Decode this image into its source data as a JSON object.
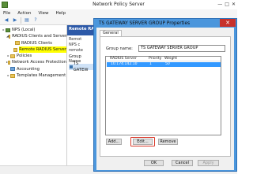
{
  "window": {
    "title": "Network Policy Server",
    "btn_min": "—",
    "btn_max": "□",
    "btn_close": "✕"
  },
  "menu": [
    "File",
    "Action",
    "View",
    "Help"
  ],
  "toolbar": {
    "icons": [
      "back-icon",
      "forward-icon",
      "properties-icon",
      "help-icon"
    ],
    "glyphs": [
      "◀",
      "▶",
      "▤",
      "?"
    ]
  },
  "tree": {
    "items": [
      {
        "label": "NPS (Local)",
        "indent": 0,
        "expander": "▸",
        "icon": "root",
        "name": "tree-item-nps-local"
      },
      {
        "label": "RADIUS Clients and Servers",
        "indent": 1,
        "expander": "◢",
        "icon": "folder",
        "name": "tree-item-radius-clients-and-servers"
      },
      {
        "label": "RADIUS Clients",
        "indent": 2,
        "expander": "",
        "icon": "folder",
        "name": "tree-item-radius-clients"
      },
      {
        "label": "Remote RADIUS Server",
        "indent": 2,
        "expander": "",
        "icon": "folder",
        "name": "tree-item-remote-radius-server",
        "selected": true
      },
      {
        "label": "Policies",
        "indent": 1,
        "expander": "▸",
        "icon": "folder",
        "name": "tree-item-policies"
      },
      {
        "label": "Network Access Protection",
        "indent": 1,
        "expander": "▸",
        "icon": "folder",
        "name": "tree-item-network-access-protection"
      },
      {
        "label": "Accounting",
        "indent": 1,
        "expander": "",
        "icon": "server",
        "name": "tree-item-accounting"
      },
      {
        "label": "Templates Management",
        "indent": 1,
        "expander": "▸",
        "icon": "folder",
        "name": "tree-item-templates-management"
      }
    ]
  },
  "right_panel": {
    "header": "Remote RAD",
    "desc_lines": [
      "Remot",
      "NPS c",
      "remote"
    ],
    "col_header_lines": [
      "Group Name"
    ],
    "row_label": "TS GATEW"
  },
  "dialog": {
    "title": "TS GATEWAY SERVER GROUP Properties",
    "close": "✕",
    "tab": "General",
    "group_name_label": "Group name:",
    "group_name_value": "TS GATEWAY SERVER GROUP",
    "list": {
      "columns": [
        "RADIUS Server",
        "Priority",
        "Weight"
      ],
      "rows": [
        {
          "server": "10.174.142.10",
          "priority": "1",
          "weight": "50"
        }
      ]
    },
    "buttons": {
      "add": "Add...",
      "edit": "Edit...",
      "remove": "Remove",
      "ok": "OK",
      "cancel": "Cancel",
      "apply": "Apply"
    }
  },
  "colors": {
    "dialog_frame": "#4b96dc",
    "highlight": "#ffff00",
    "selection": "#3399ff",
    "annotation": "#d93a2b"
  }
}
